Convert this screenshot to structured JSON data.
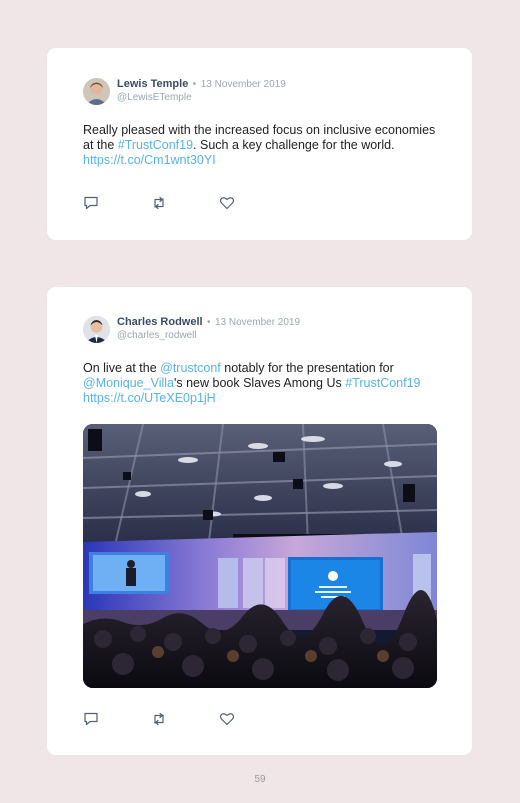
{
  "tweets": [
    {
      "name": "Lewis Temple",
      "separator": "•",
      "date": "13 November 2019",
      "handle": "@LewisETemple",
      "text_1": "Really pleased with the increased focus on inclusive economies at the ",
      "hashtag": "#TrustConf19",
      "text_2": ". Such a key challenge for the world. ",
      "link": "https://t.co/Cm1wnt30YI"
    },
    {
      "name": "Charles Rodwell",
      "separator": "•",
      "date": "13 November 2019",
      "handle": "@charles_rodwell",
      "text_1": "On live at the ",
      "mention_1": "@trustconf",
      "text_2": " notably for the presentation for ",
      "mention_2": "@Monique_Villa",
      "text_3": "'s new book Slaves Among Us ",
      "hashtag": "#TrustConf19",
      "text_4": " ",
      "link": "https://t.co/UTeXE0p1jH"
    }
  ],
  "page_number": "59",
  "colors": {
    "link": "#55b4e8",
    "name": "#3a4c60",
    "meta": "#9aa7b3",
    "background": "#f1e6e7"
  },
  "icons": [
    "reply-icon",
    "retweet-icon",
    "like-icon"
  ]
}
